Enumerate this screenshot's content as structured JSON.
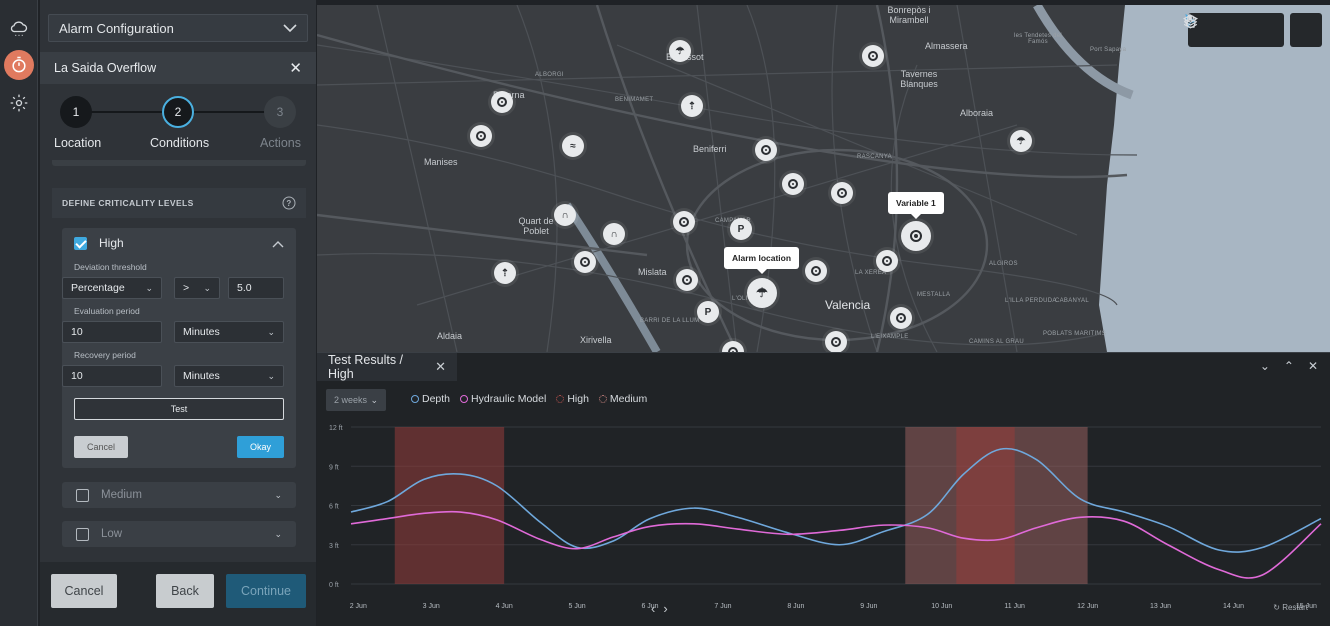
{
  "sidebar_rail": {
    "items": [
      {
        "name": "weather-cloud-icon",
        "active": false
      },
      {
        "name": "stopwatch-icon",
        "active": true
      },
      {
        "name": "gear-icon",
        "active": false
      }
    ]
  },
  "panel": {
    "dropdown_value": "Alarm Configuration",
    "title": "La Saida Overflow",
    "steps": [
      {
        "number": "1",
        "label": "Location",
        "state": "done"
      },
      {
        "number": "2",
        "label": "Conditions",
        "state": "active"
      },
      {
        "number": "3",
        "label": "Actions",
        "state": "pending"
      }
    ],
    "section_title": "DEFINE CRITICALITY LEVELS",
    "high": {
      "label": "High",
      "checked": true,
      "deviation_label": "Deviation threshold",
      "deviation_type": "Percentage",
      "operator": ">",
      "threshold_value": "5.0",
      "evaluation_label": "Evaluation period",
      "evaluation_value": "10",
      "evaluation_unit": "Minutes",
      "recovery_label": "Recovery period",
      "recovery_value": "10",
      "recovery_unit": "Minutes",
      "test_label": "Test",
      "cancel_label": "Cancel",
      "okay_label": "Okay"
    },
    "medium": {
      "label": "Medium",
      "checked": false
    },
    "low": {
      "label": "Low",
      "checked": false
    },
    "footer": {
      "cancel": "Cancel",
      "back": "Back",
      "continue": "Continue"
    }
  },
  "map": {
    "places": [
      "Burjassot",
      "Paterna",
      "Manises",
      "Quart de Poblet",
      "Mislata",
      "Valencia",
      "Aldaia",
      "Xirivella",
      "Beniferri",
      "Almassera",
      "Tavernes Blanques",
      "Alboraia",
      "Bonrepòs i Mirambell",
      "les Tendetes del Famós",
      "Port Sapaya"
    ],
    "districts": [
      "ALBORGI",
      "BENIMAMET",
      "RASCANYA",
      "LA XEREA",
      "ALGIROS",
      "MESTALLA",
      "L'EIXAMPLE",
      "CAMINS AL GRAU",
      "POBLATS MARITIMS",
      "L'ILLA PERDUDA",
      "CABANYAL",
      "BARRI DE LA LLUM",
      "CAMPANAR",
      "L'OLIVERETA"
    ],
    "callouts": {
      "alarm": "Alarm location",
      "variable": "Variable 1"
    },
    "parking_symbol": "P",
    "water_color": "#a8b6c3",
    "land_color": "#3a3d41",
    "tools": [
      "select-arrow-icon",
      "pointer-hand-icon",
      "pan-hand-icon",
      "layers-icon"
    ]
  },
  "results": {
    "tab_title": "Test Results / High",
    "close_symbol": "✕",
    "range": "2 weeks",
    "restart_label": "Restart",
    "legend": [
      {
        "label": "Depth",
        "color": "#6fa8dc"
      },
      {
        "label": "Hydraulic Model",
        "color": "#e06ad8"
      },
      {
        "label": "High",
        "color": "#c0544f"
      },
      {
        "label": "Medium",
        "color": "#c7827e"
      }
    ]
  },
  "chart_data": {
    "type": "line",
    "title": "",
    "xlabel": "",
    "ylabel": "",
    "y_ticks": [
      "0 ft",
      "3 ft",
      "6 ft",
      "9 ft",
      "12 ft"
    ],
    "ylim": [
      0,
      12
    ],
    "x_ticks": [
      "2 Jun",
      "3 Jun",
      "4 Jun",
      "5 Jun",
      "6 Jun",
      "7 Jun",
      "8 Jun",
      "9 Jun",
      "10 Jun",
      "11 Jun",
      "12 Jun",
      "13 Jun",
      "14 Jun",
      "15 Jun"
    ],
    "xlim": [
      1.9,
      15.2
    ],
    "grid": true,
    "series": [
      {
        "name": "Depth",
        "color": "#6fa8dc",
        "x": [
          1.9,
          2.4,
          2.9,
          3.4,
          3.9,
          4.5,
          5.0,
          5.5,
          6.0,
          6.6,
          7.2,
          7.9,
          8.6,
          9.2,
          9.8,
          10.3,
          10.8,
          11.3,
          11.9,
          12.5,
          13.1,
          13.8,
          14.4,
          15.2
        ],
        "y": [
          5.5,
          6.3,
          8.0,
          8.4,
          7.5,
          4.7,
          2.8,
          3.3,
          5.0,
          5.8,
          5.1,
          3.9,
          3.0,
          4.0,
          5.3,
          8.4,
          10.3,
          9.5,
          6.5,
          5.5,
          4.4,
          2.6,
          2.8,
          5.0
        ]
      },
      {
        "name": "Hydraulic Model",
        "color": "#e06ad8",
        "x": [
          1.9,
          2.4,
          2.9,
          3.4,
          3.9,
          4.5,
          5.0,
          5.5,
          6.0,
          6.6,
          7.2,
          7.9,
          8.6,
          9.2,
          9.8,
          10.3,
          10.8,
          11.3,
          11.9,
          12.5,
          13.1,
          13.8,
          14.4,
          15.2
        ],
        "y": [
          4.6,
          5.0,
          5.4,
          5.5,
          4.9,
          3.4,
          2.7,
          3.6,
          4.4,
          4.6,
          4.2,
          3.8,
          4.1,
          4.5,
          4.3,
          3.5,
          3.4,
          4.3,
          5.1,
          4.8,
          3.0,
          1.1,
          0.7,
          4.6
        ]
      }
    ],
    "bands": [
      {
        "level": "High",
        "from": 2.5,
        "to": 4.0
      },
      {
        "level": "Medium",
        "from": 9.5,
        "to": 12.0
      },
      {
        "level": "High",
        "from": 10.2,
        "to": 11.0
      }
    ]
  }
}
